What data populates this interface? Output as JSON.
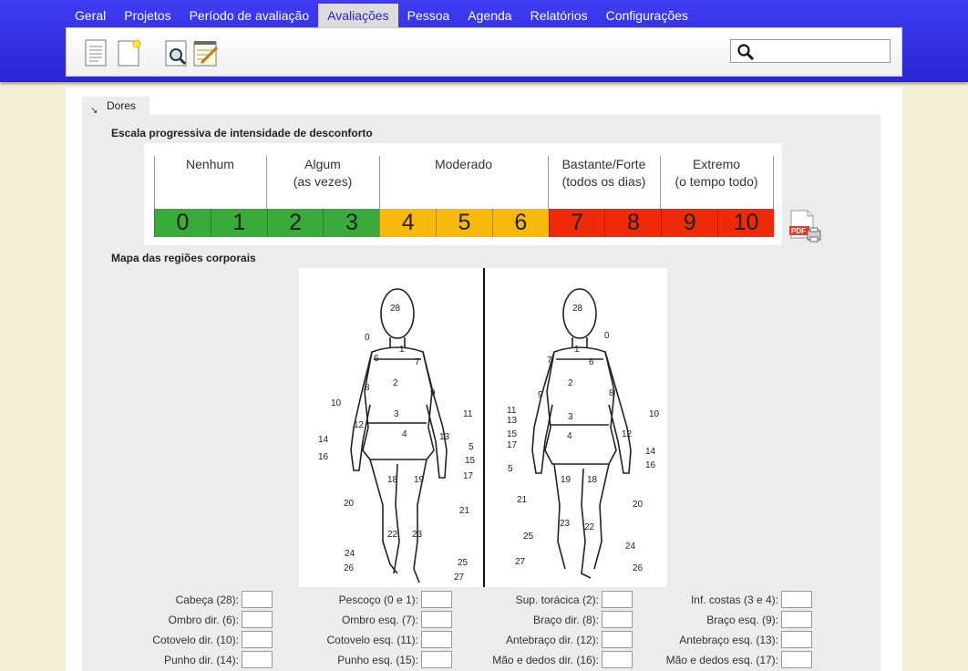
{
  "nav": {
    "items": [
      "Geral",
      "Projetos",
      "Período de avaliação",
      "Avaliações",
      "Pessoa",
      "Agenda",
      "Relatórios",
      "Configurações"
    ],
    "active": "Avaliações"
  },
  "toolbar": {
    "icons": [
      "document-icon",
      "new-document-icon",
      "search-document-icon",
      "notepad-edit-icon"
    ],
    "search_value": ""
  },
  "tab": {
    "label": "Dores"
  },
  "scale_section": {
    "title": "Escala progressiva de intensidade de desconforto",
    "headers": [
      {
        "line1": "Nenhum",
        "line2": ""
      },
      {
        "line1": "Algum",
        "line2": "(as vezes)"
      },
      {
        "line1": "Moderado",
        "line2": ""
      },
      {
        "line1": "Bastante/Forte",
        "line2": "(todos os dias)"
      },
      {
        "line1": "Extremo",
        "line2": "(o tempo todo)"
      }
    ],
    "values": [
      "0",
      "1",
      "2",
      "3",
      "4",
      "5",
      "6",
      "7",
      "8",
      "9",
      "10"
    ],
    "colors": {
      "green": "#3aaa3a",
      "yellow": "#f6b90c",
      "red": "#ee2a08"
    }
  },
  "map_section": {
    "title": "Mapa das regiões corporais",
    "front_labels": [
      "28",
      "0",
      "1",
      "6",
      "7",
      "2",
      "8",
      "9",
      "10",
      "11",
      "3",
      "12",
      "4",
      "13",
      "14",
      "16",
      "5",
      "15",
      "17",
      "18",
      "19",
      "20",
      "21",
      "22",
      "23",
      "24",
      "25",
      "26",
      "27"
    ],
    "back_labels": [
      "28",
      "0",
      "1",
      "7",
      "6",
      "2",
      "9",
      "8",
      "11",
      "13",
      "10",
      "3",
      "12",
      "15",
      "17",
      "4",
      "14",
      "16",
      "5",
      "19",
      "18",
      "21",
      "20",
      "23",
      "22",
      "25",
      "24",
      "27",
      "26"
    ]
  },
  "fields": [
    [
      "Cabeça (28):",
      "Pescoço (0 e 1):",
      "Sup. torácica (2):",
      "Inf. costas (3 e 4):"
    ],
    [
      "Ombro dir. (6):",
      "Ombro esq. (7):",
      "Braço dir. (8):",
      "Braço esq. (9):"
    ],
    [
      "Cotovelo dir. (10):",
      "Cotovelo esq. (11):",
      "Antebraço dir. (12):",
      "Antebraço esq. (13):"
    ],
    [
      "Punho dir. (14):",
      "Punho esq. (15):",
      "Mão e dedos dir. (16):",
      "Mão e dedos esq. (17):"
    ]
  ]
}
